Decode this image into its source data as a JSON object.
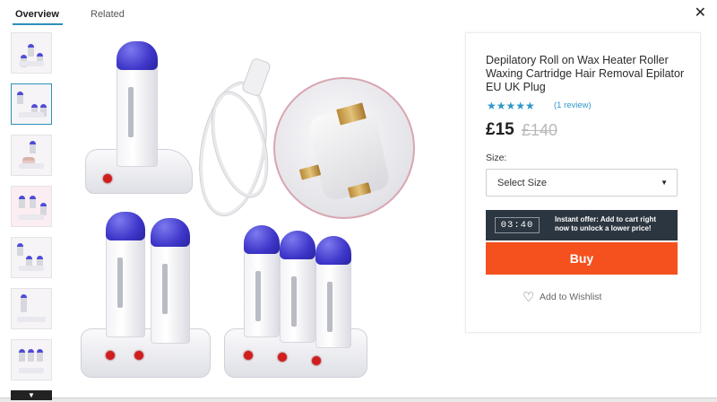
{
  "tabs": [
    {
      "label": "Overview"
    },
    {
      "label": "Related"
    }
  ],
  "close_label": "✕",
  "thumbnails_more": "▼",
  "product": {
    "title": "Depilatory Roll on Wax Heater Roller Waxing Cartridge Hair Removal Epilator EU UK Plug",
    "stars": "★★★★★",
    "rating": 5,
    "reviews": "(1 review)",
    "price": "£15",
    "old_price": "£140",
    "size_label": "Size:",
    "size_select_value": "Select Size",
    "offer_timer": "03:40",
    "offer_text": "Instant offer: Add to cart right now to unlock a lower price!",
    "buy_label": "Buy",
    "wishlist_label": "Add to Wishlist"
  },
  "colors": {
    "accent_blue": "#2f97c7",
    "buy_orange": "#f4511e",
    "offer_dark": "#2c3640",
    "cap_purple": "#3d36c9"
  }
}
